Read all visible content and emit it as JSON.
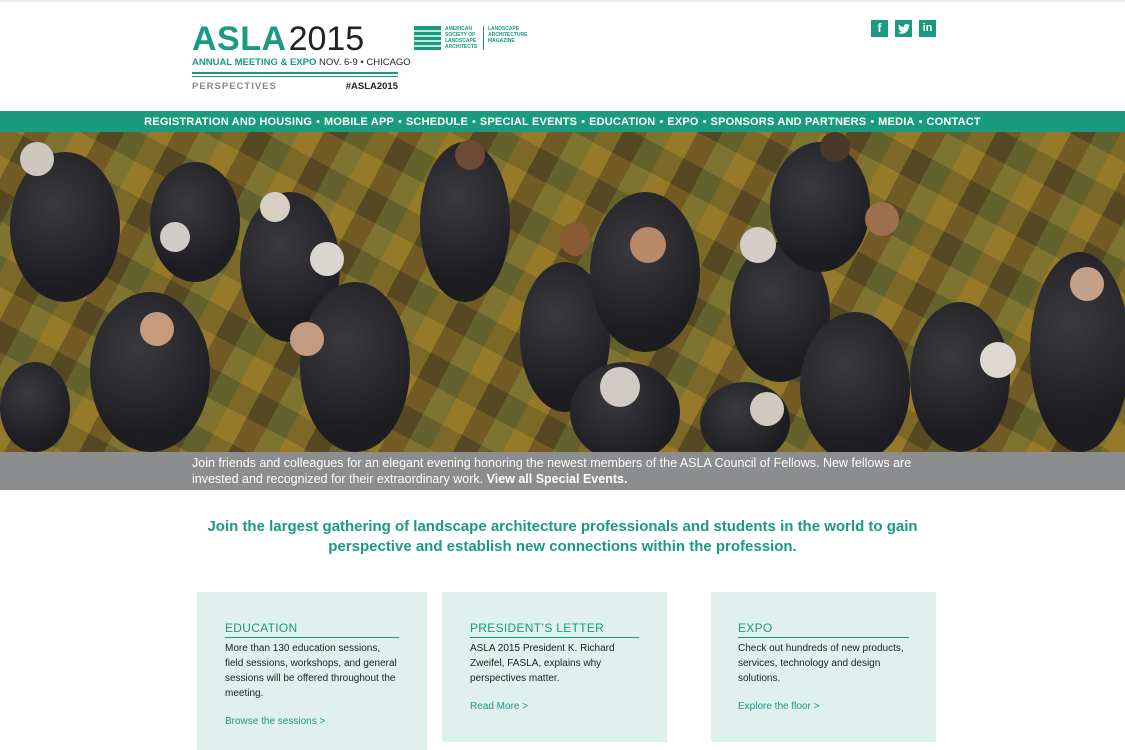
{
  "header": {
    "logo": {
      "brand": "ASLA",
      "year": "2015",
      "subtitle_green": "ANNUAL MEETING & EXPO",
      "subtitle_dark": "NOV. 6-9 • CHICAGO",
      "perspectives": "PERSPECTIVES",
      "hashtag": "#ASLA2015"
    },
    "society_logo": {
      "left_text": "AMERICAN SOCIETY OF LANDSCAPE ARCHITECTS",
      "right_text": "LANDSCAPE ARCHITECTURE MAGAZINE"
    },
    "social": [
      {
        "icon": "facebook-icon",
        "glyph": "f"
      },
      {
        "icon": "twitter-icon",
        "glyph": "t"
      },
      {
        "icon": "linkedin-icon",
        "glyph": "in"
      }
    ]
  },
  "nav": {
    "items": [
      "REGISTRATION AND HOUSING",
      "MOBILE APP",
      "SCHEDULE",
      "SPECIAL EVENTS",
      "EDUCATION",
      "EXPO",
      "SPONSORS AND PARTNERS",
      "MEDIA",
      "CONTACT"
    ],
    "separator": "•"
  },
  "hero": {
    "caption": "Join friends and colleagues for an elegant evening honoring the newest members of the ASLA Council of Fellows. New fellows are invested and recognized for their extraordinary work.",
    "caption_link": "View all Special Events."
  },
  "intro": "Join the largest gathering of landscape architecture professionals and students in the world to gain perspective and establish new connections within the profession.",
  "cards": [
    {
      "title": "EDUCATION",
      "body": "More than 130 education sessions, field sessions, workshops, and general sessions will be offered throughout the meeting.",
      "link": "Browse the sessions >"
    },
    {
      "title": "PRESIDENT’S LETTER",
      "body": "ASLA 2015 President K. Richard Zweifel, FASLA, explains why perspectives matter.",
      "link": "Read More >"
    },
    {
      "title": "EXPO",
      "body": "Check out hundreds of new products, services, technology and design solutions.",
      "link": "Explore the floor >"
    }
  ],
  "colors": {
    "brand_green": "#1a9a7f",
    "card_bg": "#dff0ed",
    "caption_bg": "#8c8d8f"
  }
}
